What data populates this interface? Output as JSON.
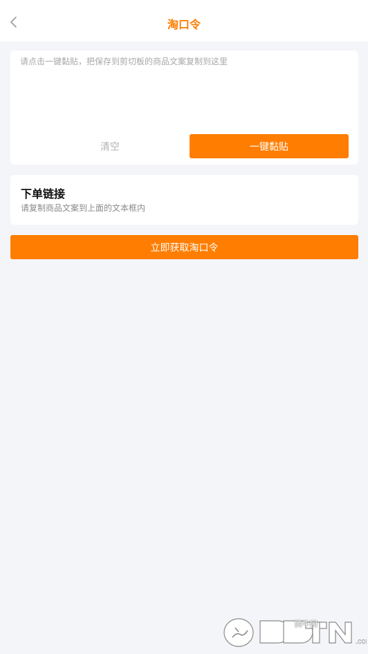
{
  "navbar": {
    "title": "淘口令",
    "back_icon": "chevron-left-icon"
  },
  "paste_card": {
    "placeholder": "请点击一键黏贴，把保存到剪切板的商品文案复制到这里",
    "value": "",
    "clear_label": "清空",
    "paste_label": "一键黏贴"
  },
  "link_card": {
    "title": "下单链接",
    "hint": "请复制商品文案到上面的文本框内"
  },
  "actions": {
    "get_label": "立即获取淘口令"
  },
  "watermark": {
    "brand": "QQTN.com",
    "site_name": "腾牛网"
  },
  "colors": {
    "accent": "#ff7d00",
    "background": "#f4f5f9",
    "card": "#ffffff"
  }
}
